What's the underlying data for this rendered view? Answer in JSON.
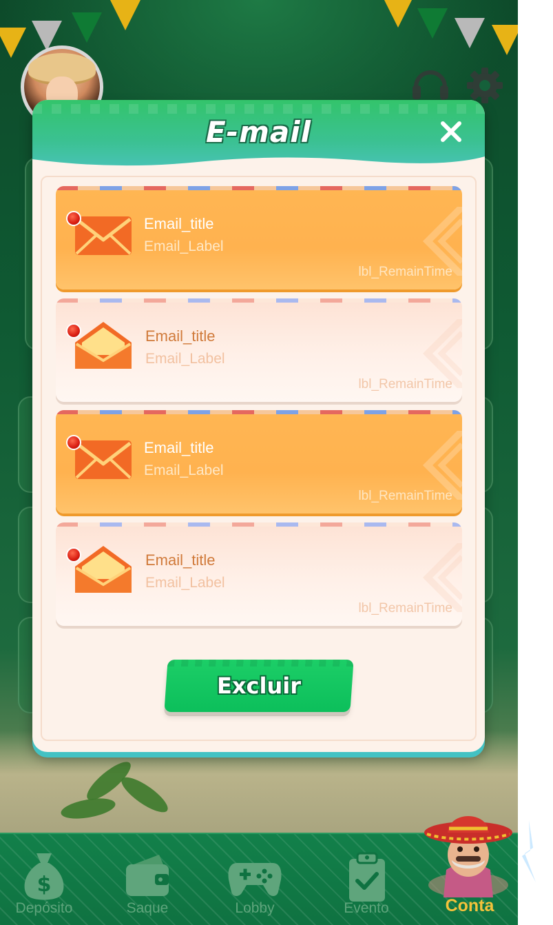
{
  "modal": {
    "title": "E-mail",
    "close_icon": "close-icon"
  },
  "mails": [
    {
      "state": "unread",
      "title": "Email_title",
      "label": "Email_Label",
      "remain_time": "lbl_RemainTime",
      "icon": "closed-envelope-icon",
      "badge": "red-dot"
    },
    {
      "state": "read",
      "title": "Email_title",
      "label": "Email_Label",
      "remain_time": "lbl_RemainTime",
      "icon": "open-envelope-icon",
      "badge": "red-dot"
    },
    {
      "state": "unread",
      "title": "Email_title",
      "label": "Email_Label",
      "remain_time": "lbl_RemainTime",
      "icon": "closed-envelope-icon",
      "badge": "red-dot"
    },
    {
      "state": "read",
      "title": "Email_title",
      "label": "Email_Label",
      "remain_time": "lbl_RemainTime",
      "icon": "open-envelope-icon",
      "badge": "red-dot"
    }
  ],
  "actions": {
    "delete_label": "Excluir"
  },
  "bottom_nav": {
    "items": [
      {
        "label": "Depósito",
        "icon": "money-bag-icon",
        "active": false
      },
      {
        "label": "Saque",
        "icon": "wallet-icon",
        "active": false
      },
      {
        "label": "Lobby",
        "icon": "gamepad-icon",
        "active": false
      },
      {
        "label": "Evento",
        "icon": "clipboard-check-icon",
        "active": false
      },
      {
        "label": "Conta",
        "icon": "mascot-avatar-icon",
        "active": true
      }
    ]
  },
  "header": {
    "icons": [
      "avatar",
      "headset-icon",
      "gear-icon"
    ]
  },
  "colors": {
    "header_green": "#33c46b",
    "unread_card": "#ffb653",
    "read_card": "#fde2d4",
    "delete_button": "#0cbf5b",
    "active_nav": "#f4c23b",
    "inactive_nav": "#5fa57c"
  }
}
